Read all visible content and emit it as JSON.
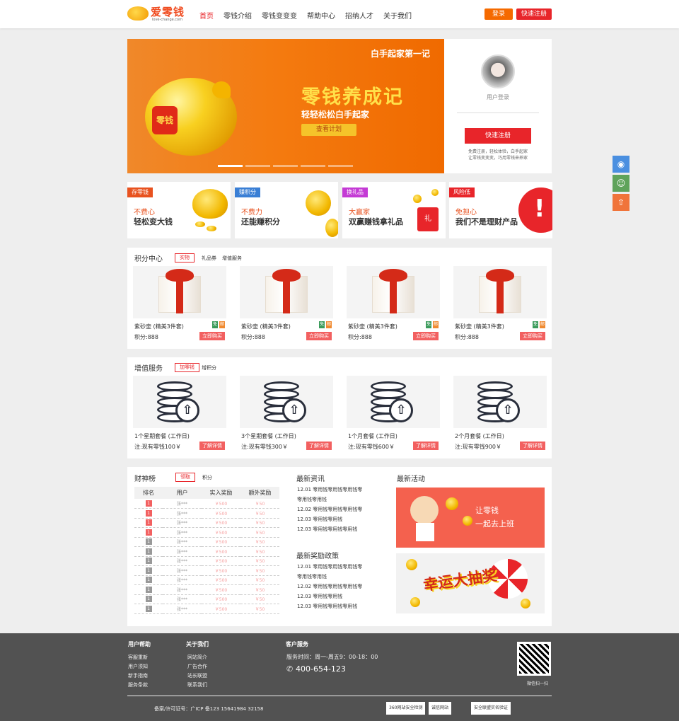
{
  "header": {
    "logo_name": "爱零钱",
    "logo_url": "love-change.com",
    "nav": [
      "首页",
      "零钱介绍",
      "零钱变变变",
      "帮助中心",
      "招纳人才",
      "关于我们"
    ],
    "active_nav": "首页",
    "login_label": "登录",
    "register_label": "快速注册"
  },
  "banner": {
    "subtitle": "白手起家第一记",
    "title": "零钱养成记",
    "slogan": "轻轻松松白手起家",
    "button_label": "查看计划",
    "pig_seal": "零钱",
    "slides": 5,
    "active_slide": 1
  },
  "login_card": {
    "user_label": "用户登录",
    "register_button": "快速注册",
    "tip_line1": "免费注册，轻松体验，白手起家",
    "tip_line2": "让零钱变变变，巧用零钱来养家"
  },
  "features": [
    {
      "tag": "存零钱",
      "line1": "不费心",
      "line2": "轻松变大钱",
      "color": "#e8521f"
    },
    {
      "tag": "赚积分",
      "line1": "不费力",
      "line2": "还能赚积分",
      "color": "#3a7fd5"
    },
    {
      "tag": "换礼品",
      "line1": "大赢家",
      "line2": "双赢赚钱拿礼品",
      "color": "#c43ad5"
    },
    {
      "tag": "风险低",
      "line1": "免担心",
      "line2": "我们不是理财产品",
      "color": "#e8252a"
    }
  ],
  "points_center": {
    "title": "积分中心",
    "tabs": [
      "实物",
      "礼品券",
      "增值服务"
    ],
    "products": [
      {
        "name": "紫砂壶 (精美3件套)",
        "points": "积分:888",
        "buy": "立即购买",
        "badge1": "免",
        "badge2": "邮"
      },
      {
        "name": "紫砂壶 (精美3件套)",
        "points": "积分:888",
        "buy": "立即购买",
        "badge1": "免",
        "badge2": "邮"
      },
      {
        "name": "紫砂壶 (精美3件套)",
        "points": "积分:888",
        "buy": "立即购买",
        "badge1": "免",
        "badge2": "邮"
      },
      {
        "name": "紫砂壶 (精美3件套)",
        "points": "积分:888",
        "buy": "立即购买",
        "badge1": "免",
        "badge2": "邮"
      }
    ]
  },
  "value_added": {
    "title": "增值服务",
    "tabs": [
      "加零钱",
      "增积分"
    ],
    "packages": [
      {
        "name": "1个星期套餐 (工作日)",
        "note": "注:现有零钱100￥",
        "btn": "了解详情"
      },
      {
        "name": "3个星期套餐 (工作日)",
        "note": "注:现有零钱300￥",
        "btn": "了解详情"
      },
      {
        "name": "1个月套餐 (工作日)",
        "note": "注:现有零钱600￥",
        "btn": "了解详情"
      },
      {
        "name": "2个月套餐 (工作日)",
        "note": "注:现有零钱900￥",
        "btn": "了解详情"
      }
    ]
  },
  "leaderboard": {
    "title": "财神榜",
    "tabs": [
      "领取",
      "积分"
    ],
    "columns": [
      "排名",
      "用户",
      "实入奖励",
      "额外奖励"
    ],
    "rows": [
      {
        "rank": "1",
        "user": "张***",
        "reward": "￥500",
        "extra": "￥50"
      },
      {
        "rank": "1",
        "user": "张***",
        "reward": "￥500",
        "extra": "￥50"
      },
      {
        "rank": "1",
        "user": "张***",
        "reward": "￥500",
        "extra": "￥50"
      },
      {
        "rank": "1",
        "user": "张***",
        "reward": "￥500",
        "extra": "￥50"
      },
      {
        "rank": "1",
        "user": "张***",
        "reward": "￥500",
        "extra": "￥50"
      },
      {
        "rank": "1",
        "user": "张***",
        "reward": "￥500",
        "extra": "￥50"
      },
      {
        "rank": "1",
        "user": "张***",
        "reward": "￥500",
        "extra": "￥50"
      },
      {
        "rank": "1",
        "user": "张***",
        "reward": "￥500",
        "extra": "￥50"
      },
      {
        "rank": "1",
        "user": "张***",
        "reward": "￥500",
        "extra": "￥50"
      },
      {
        "rank": "1",
        "user": "张***",
        "reward": "￥500",
        "extra": "￥50"
      },
      {
        "rank": "1",
        "user": "张***",
        "reward": "￥500",
        "extra": "￥50"
      },
      {
        "rank": "1",
        "user": "张***",
        "reward": "￥500",
        "extra": "￥50"
      }
    ],
    "highlight_rows": 4
  },
  "news": {
    "title": "最新资讯",
    "items": [
      "12.01 零用钱零用钱零用钱零",
      "零用钱零用钱",
      "12.02 零用钱零用钱零用钱零",
      "12.03 零用钱零用钱",
      "12.03 零用钱零用钱零用钱"
    ]
  },
  "policy": {
    "title": "最新奖励政策",
    "items": [
      "12.01 零用钱零用钱零用钱零",
      "零用钱零用钱",
      "12.02 零用钱零用钱零用钱零",
      "12.03 零用钱零用钱",
      "12.03 零用钱零用钱零用钱"
    ]
  },
  "activity": {
    "title": "最新活动",
    "ad1_line1": "让零钱",
    "ad1_line2": "一起去上班",
    "ad2_text": "幸运大抽奖"
  },
  "footer": {
    "help_title": "用户帮助",
    "help_items": [
      "客服重新",
      "用户须知",
      "新手指南",
      "服务条款"
    ],
    "about_title": "关于我们",
    "about_items": [
      "网站简介",
      "广告合作",
      "站长联盟",
      "联系我们"
    ],
    "service_title": "客户服务",
    "service_hours": "服务时间：周一-周五9：00-18：00",
    "phone": "400-654-123",
    "qr_label": "微信扫一扫",
    "icp": "备案/许可证号：广ICP 备123 15641984 32158",
    "seals": [
      "360网站安全检测",
      "诚信网站",
      "安全联盟实名验证"
    ]
  }
}
